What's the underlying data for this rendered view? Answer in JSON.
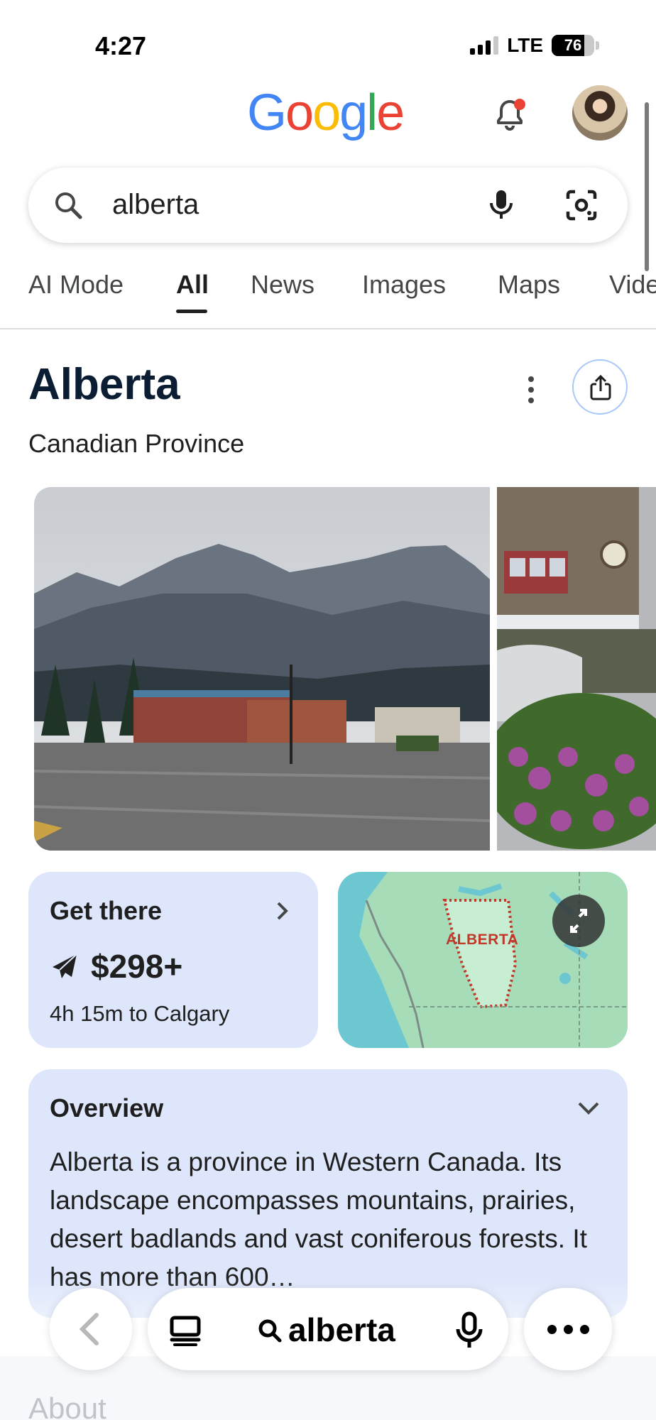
{
  "status_bar": {
    "time": "4:27",
    "network": "LTE",
    "battery": "76",
    "battery_level_percent": 76
  },
  "header": {
    "logo": "Google",
    "notification_icon": "bell-icon",
    "avatar": "profile-avatar"
  },
  "search": {
    "query": "alberta",
    "icons": [
      "search-icon",
      "mic-icon",
      "lens-icon"
    ]
  },
  "tabs": [
    {
      "label": "AI Mode"
    },
    {
      "label": "All",
      "active": true
    },
    {
      "label": "News"
    },
    {
      "label": "Images"
    },
    {
      "label": "Maps"
    },
    {
      "label": "Vide"
    }
  ],
  "knowledge_panel": {
    "title": "Alberta",
    "subtitle": "Canadian Province"
  },
  "get_there": {
    "title": "Get there",
    "price": "$298+",
    "duration": "4h 15m to Calgary"
  },
  "map": {
    "label": "ALBERTA"
  },
  "overview": {
    "title": "Overview",
    "text": "Alberta is a province in Western Canada. Its landscape encompasses mountains, prairies, desert badlands and vast coniferous forests. It has more than 600…"
  },
  "about": {
    "label": "About"
  },
  "bottom_bar": {
    "query": "alberta"
  },
  "colors": {
    "google_blue": "#4285F4",
    "google_red": "#EA4335",
    "google_yellow": "#FBBC05",
    "google_green": "#34A853",
    "card_bg": "#dde6fb"
  }
}
